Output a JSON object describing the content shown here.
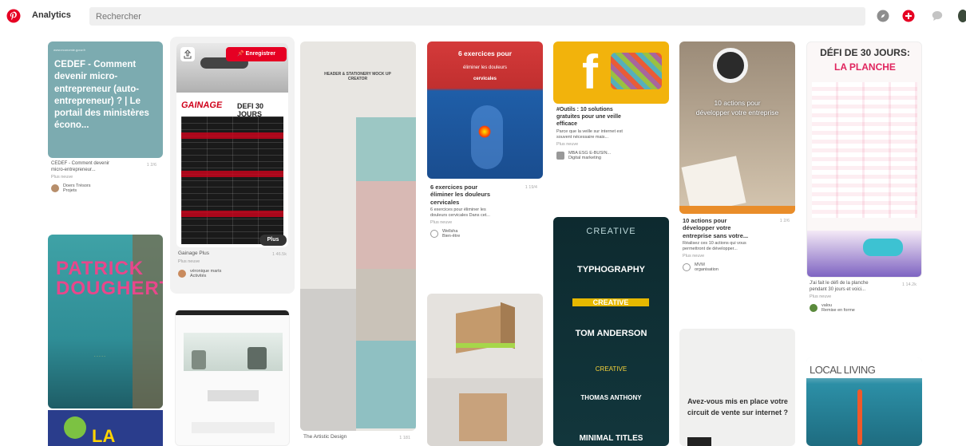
{
  "header": {
    "analytics_label": "Analytics",
    "search_placeholder": "Rechercher"
  },
  "colors": {
    "brand": "#e60023",
    "search_bg": "#efefef"
  },
  "icons": [
    "pinterest-logo-icon",
    "compass-icon",
    "add-icon",
    "chat-icon",
    "profile-icon"
  ],
  "pins": {
    "cedef": {
      "image_text": "CEDEF - Comment devenir micro-entrepreneur (auto-entrepreneur) ? | Le portail des ministères écono...",
      "title": "CEDEF - Comment devenir micro-entrepreneur...",
      "count": "1 2/6",
      "link": "Plus neuve",
      "user": "Doers Trésors",
      "board": "Projets"
    },
    "gainage": {
      "save_label": "Enregistrer",
      "image_title_left": "GAINAGE",
      "image_title_right": "DEFI 30 JOURS",
      "more_label": "Plus",
      "title": "Gainage Plus",
      "count": "1 46.5k",
      "link": "Plus neuve",
      "user": "véronique marts",
      "board": "Activités"
    },
    "mockup": {
      "image_title": "HEADER & STATIONERY MOCK UP CREATOR",
      "title": "The Artistic Design",
      "count": "1 181"
    },
    "cervicales": {
      "image_line1": "6 exercices pour",
      "image_line2": "éliminer les douleurs",
      "image_line3": "cervicales",
      "title": "6 exercices pour éliminer les douleurs cervicales",
      "count": "1 19/4",
      "desc": "6 exercices pour éliminer les douleurs cervicales Dans cet...",
      "link": "Plus neuve",
      "user": "Wellsha",
      "board": "Bien-être"
    },
    "outils": {
      "title": "#Outils : 10 solutions gratuites pour une veille efficace",
      "desc": "Parce que la veille sur internet est souvent nécessaire mais...",
      "link": "Plus neuve",
      "user": "MBA ESG E-BUSIN...",
      "board": "Digital marketing"
    },
    "creative": {
      "lines": [
        "CREATIVE",
        "TYPHOGRAPHY",
        "CREATIVE",
        "TOM ANDERSON",
        "CREATIVE",
        "THOMAS ANTHONY",
        "MINIMAL TITLES"
      ]
    },
    "actions": {
      "image_line1": "10 actions pour",
      "image_line2": "développer votre entreprise",
      "title": "10 actions pour développer votre entreprise sans votre...",
      "count": "1 2/6",
      "desc": "Réalisez ces 10 actions qui vous permettront de développer...",
      "link": "Plus neuve",
      "user": "MVM",
      "board": "organisation"
    },
    "circuit": {
      "text": "Avez-vous mis en place votre circuit de vente sur internet ?"
    },
    "planche": {
      "image_title1": "DÉFI DE 30 JOURS:",
      "image_title2": "LA PLANCHE",
      "title": "J'ai fait le défi de la planche pendant 30 jours et voici...",
      "count": "1 14.2k",
      "link": "Plus neuve",
      "user": "valou",
      "board": "Remise en forme"
    },
    "local": {
      "image_title": "LOCAL LIVING"
    },
    "patrick": {
      "image_text": "PATRICK DOUGHERTY"
    },
    "la": {
      "image_text": "LA"
    }
  }
}
